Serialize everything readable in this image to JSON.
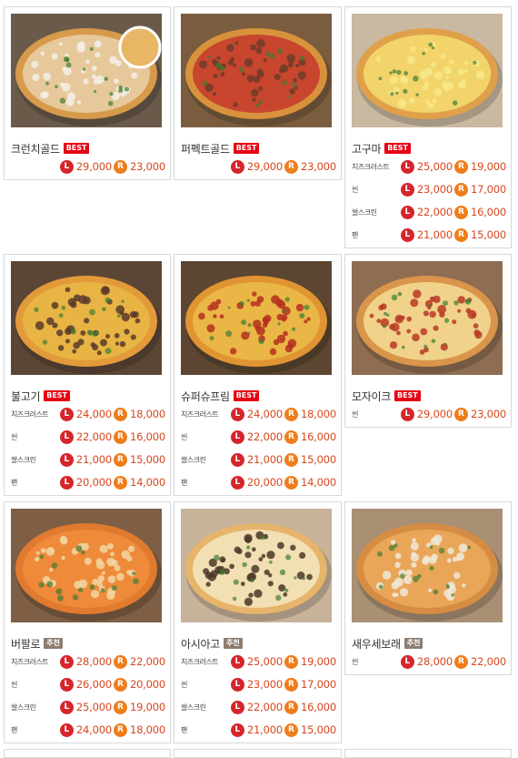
{
  "menu": [
    {
      "name": "크런치골드",
      "badge": "BEST",
      "badge_type": "best",
      "prices": [
        {
          "variant": "",
          "L": "29,000",
          "R": "23,000"
        }
      ]
    },
    {
      "name": "퍼펙트골드",
      "badge": "BEST",
      "badge_type": "best",
      "prices": [
        {
          "variant": "",
          "L": "29,000",
          "R": "23,000"
        }
      ]
    },
    {
      "name": "고구마",
      "badge": "BEST",
      "badge_type": "best",
      "prices": [
        {
          "variant": "치즈크러스트",
          "L": "25,000",
          "R": "19,000"
        },
        {
          "variant": "씬",
          "L": "23,000",
          "R": "17,000"
        },
        {
          "variant": "쌀스크린",
          "L": "22,000",
          "R": "16,000"
        },
        {
          "variant": "팬",
          "L": "21,000",
          "R": "15,000"
        }
      ]
    },
    {
      "name": "불고기",
      "badge": "BEST",
      "badge_type": "best",
      "prices": [
        {
          "variant": "치즈크러스트",
          "L": "24,000",
          "R": "18,000"
        },
        {
          "variant": "씬",
          "L": "22,000",
          "R": "16,000"
        },
        {
          "variant": "쌀스크린",
          "L": "21,000",
          "R": "15,000"
        },
        {
          "variant": "팬",
          "L": "20,000",
          "R": "14,000"
        }
      ]
    },
    {
      "name": "슈퍼슈프림",
      "badge": "BEST",
      "badge_type": "best",
      "prices": [
        {
          "variant": "치즈크러스트",
          "L": "24,000",
          "R": "18,000"
        },
        {
          "variant": "씬",
          "L": "22,000",
          "R": "16,000"
        },
        {
          "variant": "쌀스크린",
          "L": "21,000",
          "R": "15,000"
        },
        {
          "variant": "팬",
          "L": "20,000",
          "R": "14,000"
        }
      ]
    },
    {
      "name": "모자이크",
      "badge": "BEST",
      "badge_type": "best",
      "prices": [
        {
          "variant": "씬",
          "L": "29,000",
          "R": "23,000"
        }
      ]
    },
    {
      "name": "버팔로",
      "badge": "추천",
      "badge_type": "rec",
      "prices": [
        {
          "variant": "치즈크러스트",
          "L": "28,000",
          "R": "22,000"
        },
        {
          "variant": "씬",
          "L": "26,000",
          "R": "20,000"
        },
        {
          "variant": "쌀스크린",
          "L": "25,000",
          "R": "19,000"
        },
        {
          "variant": "팬",
          "L": "24,000",
          "R": "18,000"
        }
      ]
    },
    {
      "name": "아시아고",
      "badge": "추천",
      "badge_type": "rec",
      "prices": [
        {
          "variant": "치즈크러스트",
          "L": "25,000",
          "R": "19,000"
        },
        {
          "variant": "씬",
          "L": "23,000",
          "R": "17,000"
        },
        {
          "variant": "쌀스크린",
          "L": "22,000",
          "R": "16,000"
        },
        {
          "variant": "팬",
          "L": "21,000",
          "R": "15,000"
        }
      ]
    },
    {
      "name": "새우세보래",
      "badge": "추천",
      "badge_type": "rec",
      "prices": [
        {
          "variant": "씬",
          "L": "28,000",
          "R": "22,000"
        }
      ]
    }
  ],
  "size_labels": {
    "L": "L",
    "R": "R"
  },
  "colors": {
    "best_badge": "#e60012",
    "rec_badge": "#8c7c70",
    "price": "#d6471e",
    "L_circle": "#d6252c",
    "R_circle": "#ef7d1a"
  },
  "photos": [
    {
      "icon": "crunch-gold-pizza-photo",
      "bg": "#6a5a4a",
      "crust": "#d69a4a",
      "sauce": "#e6c89a",
      "top": "#f3efe6"
    },
    {
      "icon": "perfect-gold-pizza-photo",
      "bg": "#7a5d3f",
      "crust": "#d9923c",
      "sauce": "#c8452e",
      "top": "#6e3b28"
    },
    {
      "icon": "sweet-potato-pizza-photo",
      "bg": "#c9b9a0",
      "crust": "#e0a04a",
      "sauce": "#f2d46a",
      "top": "#f8e78a"
    },
    {
      "icon": "bulgogi-pizza-photo",
      "bg": "#5b4636",
      "crust": "#e39a3a",
      "sauce": "#e8b443",
      "top": "#5a3a2a"
    },
    {
      "icon": "super-supreme-pizza-photo",
      "bg": "#5c4631",
      "crust": "#e19432",
      "sauce": "#eab646",
      "top": "#b5301f"
    },
    {
      "icon": "mosaic-pizza-photo",
      "bg": "#8e6d52",
      "crust": "#d9954a",
      "sauce": "#f0d28a",
      "top": "#b93a26"
    },
    {
      "icon": "buffalo-pizza-photo",
      "bg": "#7e5e44",
      "crust": "#e07a2e",
      "sauce": "#ee8a3a",
      "top": "#f2d6a2"
    },
    {
      "icon": "asiago-pizza-photo",
      "bg": "#c7b29a",
      "crust": "#e6b46a",
      "sauce": "#f3dfb4",
      "top": "#4a3828"
    },
    {
      "icon": "shrimp-pizza-photo",
      "bg": "#a98f73",
      "crust": "#d68d43",
      "sauce": "#e9a659",
      "top": "#f0e8d8"
    }
  ]
}
